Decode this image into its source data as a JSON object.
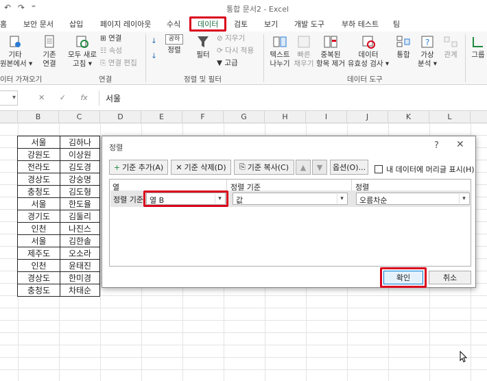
{
  "app": {
    "title": "통합 문서2 - Excel",
    "qat_undo": "↶",
    "qat_redo": "↷",
    "qat_more": "⁼"
  },
  "tabs": [
    "홈",
    "보안 문서",
    "삽입",
    "페이지 레이아웃",
    "수식",
    "데이터",
    "검토",
    "보기",
    "개발 도구",
    "부하 테스트",
    "팀"
  ],
  "active_tab": "데이터",
  "ribbon": {
    "get_external_line1": "기타",
    "get_external_line2": "원본에서 ▾",
    "existing_line1": "기존",
    "existing_line2": "연결",
    "refresh_line1": "모두 새로",
    "refresh_line2": "고침 ▾",
    "connections": "연결",
    "properties": "속성",
    "edit_links": "연결 편집",
    "sort_az": "↓",
    "sort_za": "↓",
    "sort": "정렬",
    "sort_icon_label": "공하",
    "filter": "필터",
    "clear": "지우기",
    "reapply": "다시 적용",
    "advanced": "고급",
    "text_to_columns_1": "텍스트",
    "text_to_columns_2": "나누기",
    "flash_fill_1": "빠른",
    "flash_fill_2": "채우기",
    "remove_dup_1": "중복된",
    "remove_dup_2": "항목 제거",
    "validation_1": "데이터",
    "validation_2": "유효성 검사 ▾",
    "consolidate": "통합",
    "whatif_1": "가상",
    "whatif_2": "분석 ▾",
    "relationships": "관계",
    "group": "그룹",
    "group_labels": {
      "get_external": "이터 가져오기",
      "connections": "연결",
      "sort_filter": "정렬 및 필터",
      "data_tools": "데이터 도구"
    }
  },
  "formula_bar": {
    "name_box_arrow": "▾",
    "cancel": "✕",
    "enter": "✓",
    "fx": "fx",
    "value": "서울"
  },
  "columns": [
    "B",
    "C",
    "D",
    "E",
    "F",
    "G",
    "H",
    "I",
    "J",
    "K",
    "L"
  ],
  "table": [
    [
      "서울",
      "김하나"
    ],
    [
      "강원도",
      "이상원"
    ],
    [
      "전라도",
      "김도경"
    ],
    [
      "경상도",
      "강숭명"
    ],
    [
      "충청도",
      "김도형"
    ],
    [
      "서울",
      "한도율"
    ],
    [
      "경기도",
      "김둘리"
    ],
    [
      "인천",
      "나진스"
    ],
    [
      "서울",
      "김한솔"
    ],
    [
      "제주도",
      "오소라"
    ],
    [
      "인천",
      "윤태진"
    ],
    [
      "경상도",
      "한미경"
    ],
    [
      "충청도",
      "차태순"
    ]
  ],
  "dialog": {
    "title": "정렬",
    "help": "?",
    "close": "✕",
    "add_level": "기준 추가(A)",
    "delete_level": "기준 삭제(D)",
    "copy_level": "기준 복사(C)",
    "move_up": "▲",
    "move_down": "▼",
    "options": "옵션(O)...",
    "has_headers_label": "내 데이터에 머리글 표시(H)",
    "col_header_column": "열",
    "col_header_sorton": "정렬 기준",
    "col_header_order": "정렬",
    "row_label": "정렬 기준",
    "column_value": "열 B",
    "sorton_value": "값",
    "order_value": "오름차순",
    "ok": "확인",
    "cancel": "취소"
  },
  "colors": {
    "highlight": "#d9001b",
    "excel_green": "#1d6f42"
  }
}
